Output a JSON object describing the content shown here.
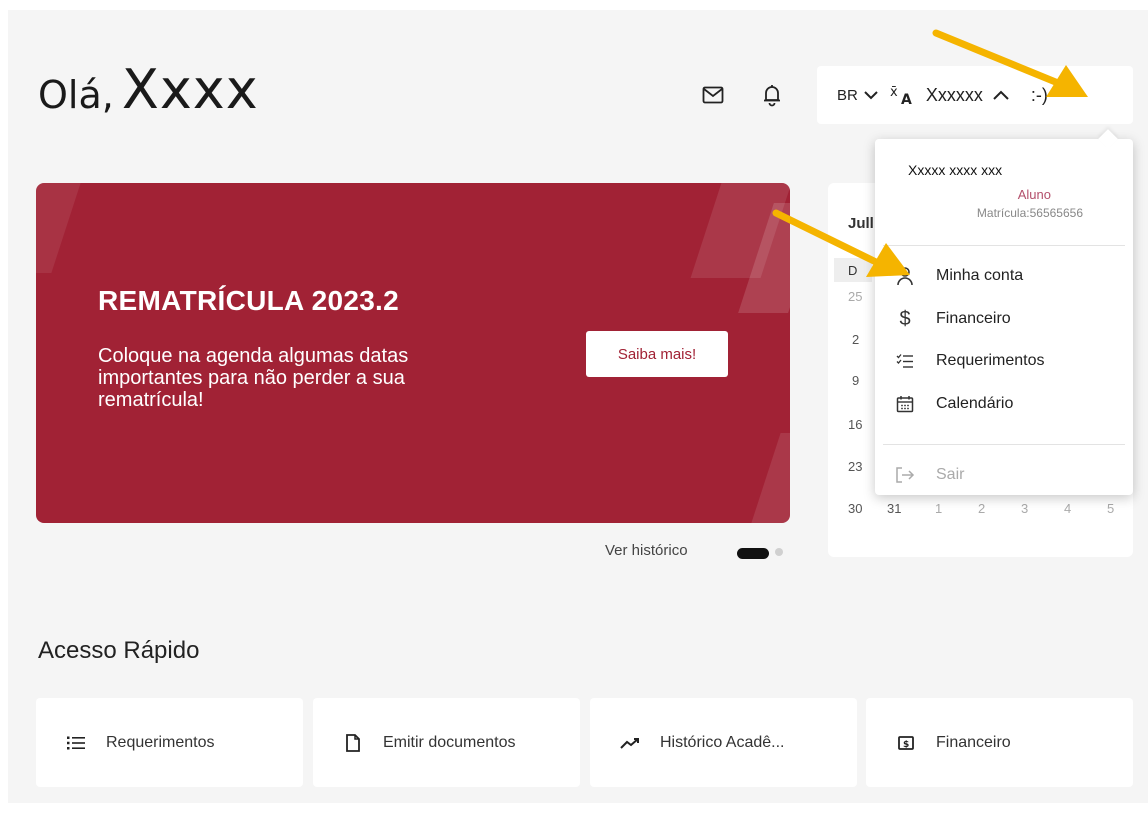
{
  "header": {
    "greeting": "Olá,",
    "user_name": "Xxxx",
    "mail_icon": "mail-icon",
    "bell_icon": "bell-icon"
  },
  "user_bar": {
    "language": "BR",
    "translate_icon": "translate-icon",
    "username": "Xxxxxx",
    "smiley": ":-)"
  },
  "banner": {
    "title": "REMATRÍCULA 2023.2",
    "text": "Coloque na agenda algumas datas importantes para não perder a sua rematrícula!",
    "button_label": "Saiba mais!",
    "background_color": "#a12235"
  },
  "carousel": {
    "history_link": "Ver histórico"
  },
  "calendar": {
    "month_partial": "Jull",
    "weekday_partial": "D",
    "first_column": [
      "25",
      "2",
      "9",
      "16",
      "23"
    ],
    "last_row": [
      "30",
      "31",
      "1",
      "2",
      "3",
      "4",
      "5"
    ]
  },
  "user_menu": {
    "full_name": "Xxxxx xxxx xxx",
    "role": "Aluno",
    "registration": "Matrícula:56565656",
    "items": [
      {
        "label": "Minha conta",
        "icon": "person-icon"
      },
      {
        "label": "Financeiro",
        "icon": "dollar-icon"
      },
      {
        "label": "Requerimentos",
        "icon": "checklist-icon"
      },
      {
        "label": "Calendário",
        "icon": "calendar-icon"
      }
    ],
    "logout_label": "Sair"
  },
  "quick_access": {
    "title": "Acesso Rápido",
    "cards": [
      {
        "label": "Requerimentos",
        "icon": "list-icon"
      },
      {
        "label": "Emitir documentos",
        "icon": "document-icon"
      },
      {
        "label": "Histórico Acadê...",
        "icon": "trending-icon"
      },
      {
        "label": "Financeiro",
        "icon": "money-icon"
      }
    ]
  },
  "colors": {
    "accent": "#a12235",
    "annotation_arrow": "#f5b400"
  }
}
